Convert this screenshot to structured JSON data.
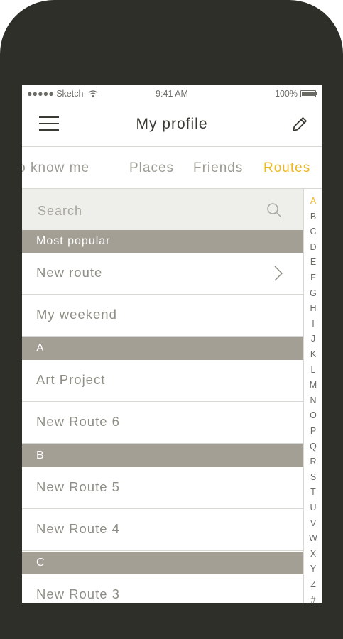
{
  "status_bar": {
    "carrier": "●●●●● Sketch",
    "time": "9:41 AM",
    "battery": "100%"
  },
  "navbar": {
    "title": "My profile"
  },
  "tabs": [
    {
      "label": "Get to know me"
    },
    {
      "label": "Places"
    },
    {
      "label": "Friends"
    },
    {
      "label": "Routes"
    }
  ],
  "search": {
    "placeholder": "Search"
  },
  "sections": [
    {
      "header": "Most popular",
      "rows": [
        "New route",
        "My weekend"
      ]
    },
    {
      "header": "A",
      "rows": [
        "Art Project",
        "New Route 6"
      ]
    },
    {
      "header": "B",
      "rows": [
        "New Route 5",
        "New Route 4"
      ]
    },
    {
      "header": "C",
      "rows": [
        "New Route 3"
      ]
    }
  ],
  "index_letters": [
    "A",
    "B",
    "C",
    "D",
    "E",
    "F",
    "G",
    "H",
    "I",
    "J",
    "K",
    "L",
    "M",
    "N",
    "O",
    "P",
    "Q",
    "R",
    "S",
    "T",
    "U",
    "V",
    "W",
    "X",
    "Y",
    "Z",
    "#"
  ],
  "colors": {
    "accent": "#f0b820",
    "section_bg": "#a39f95",
    "device": "#2f2f2a"
  },
  "icons": {
    "menu": "hamburger-icon",
    "edit": "pencil-icon",
    "search": "search-icon",
    "chevron": "chevron-right-icon"
  }
}
